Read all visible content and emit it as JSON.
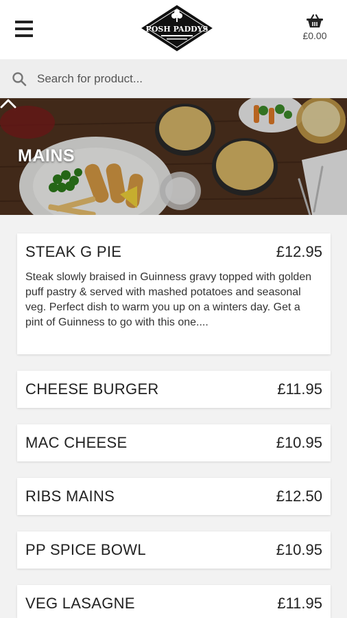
{
  "header": {
    "logo_text": "POSH PADDYS",
    "basket_total": "£0.00"
  },
  "search": {
    "placeholder": "Search for product..."
  },
  "category": {
    "title": "MAINS"
  },
  "products": [
    {
      "name": "STEAK G PIE",
      "price": "£12.95",
      "description": "Steak slowly braised in Guinness gravy topped with golden puff pastry & served with mashed potatoes and seasonal veg. Perfect dish to warm you up on a winters day. Get a pint of Guinness to go with this one...."
    },
    {
      "name": "CHEESE BURGER",
      "price": "£11.95"
    },
    {
      "name": "MAC CHEESE",
      "price": "£10.95"
    },
    {
      "name": "RIBS MAINS",
      "price": "£12.50"
    },
    {
      "name": "PP SPICE BOWL",
      "price": "£10.95"
    },
    {
      "name": "VEG LASAGNE",
      "price": "£11.95"
    }
  ]
}
